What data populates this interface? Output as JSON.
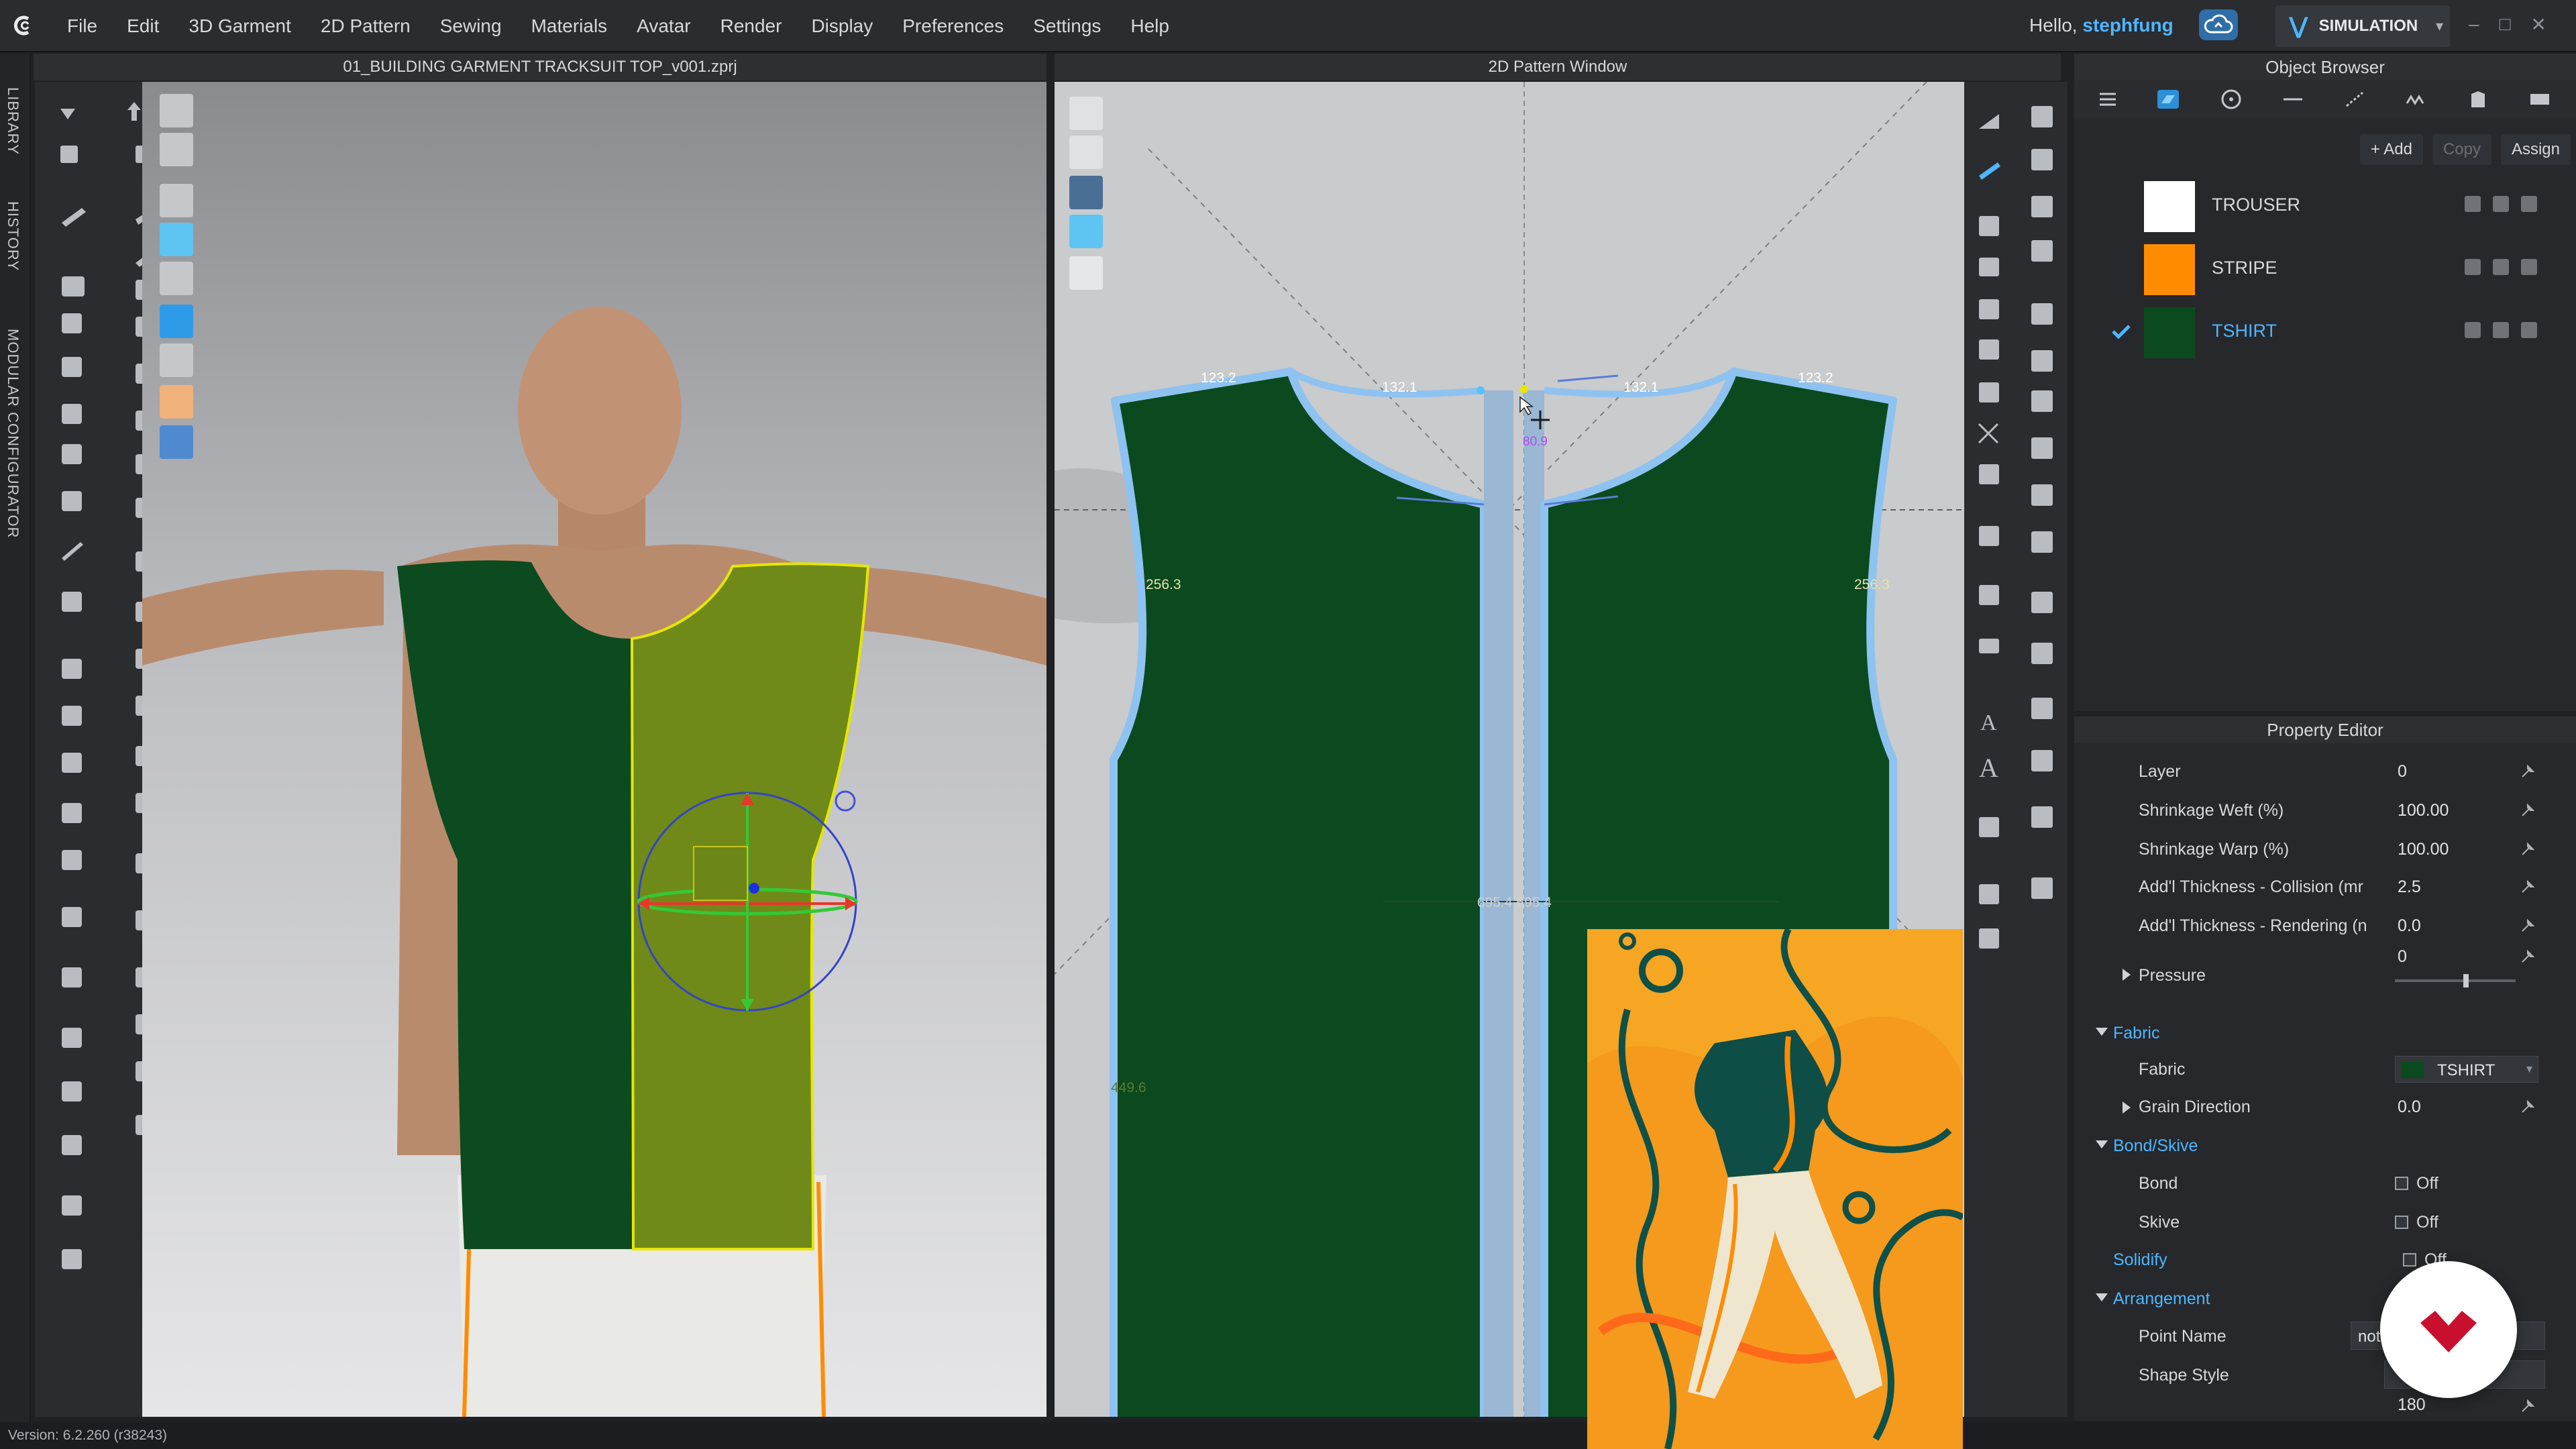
{
  "menubar": {
    "items": [
      "File",
      "Edit",
      "3D Garment",
      "2D Pattern",
      "Sewing",
      "Materials",
      "Avatar",
      "Render",
      "Display",
      "Preferences",
      "Settings",
      "Help"
    ],
    "greeting": "Hello,",
    "username": "stephfung",
    "mode_label": "SIMULATION"
  },
  "left_tabs": [
    "LIBRARY",
    "HISTORY",
    "MODULAR CONFIGURATOR"
  ],
  "window3d": {
    "title": "01_BUILDING GARMENT TRACKSUIT TOP_v001.zprj"
  },
  "window2d": {
    "title": "2D Pattern Window",
    "measurements": {
      "shoulder_left": "123.2",
      "neck_left": "132.1",
      "neck_right": "132.1",
      "shoulder_right": "123.2",
      "center_small": "80.9",
      "armhole_left": "256.3",
      "armhole_right": "256.3",
      "center_width": "695.4 695.4",
      "side_length": "449.6"
    }
  },
  "object_browser": {
    "title": "Object Browser",
    "actions": {
      "add": "+ Add",
      "copy": "Copy",
      "assign": "Assign"
    },
    "fabrics": [
      {
        "name": "TROUSER",
        "color": "#ffffff",
        "active": false
      },
      {
        "name": "STRIPE",
        "color": "#ff8c00",
        "active": false
      },
      {
        "name": "TSHIRT",
        "color": "#0b4a1e",
        "active": true
      }
    ]
  },
  "property_editor": {
    "title": "Property Editor",
    "layer": {
      "label": "Layer",
      "value": "0"
    },
    "shrink_weft": {
      "label": "Shrinkage Weft (%)",
      "value": "100.00"
    },
    "shrink_warp": {
      "label": "Shrinkage Warp (%)",
      "value": "100.00"
    },
    "thick_collision": {
      "label": "Add'l Thickness - Collision (mr",
      "value": "2.5"
    },
    "thick_render": {
      "label": "Add'l Thickness - Rendering (n",
      "value": "0.0"
    },
    "pressure_value": "0",
    "pressure": {
      "label": "Pressure"
    },
    "fabric_section": "Fabric",
    "fabric": {
      "label": "Fabric",
      "value": "TSHIRT"
    },
    "grain": {
      "label": "Grain Direction",
      "value": "0.0"
    },
    "bond_section": "Bond/Skive",
    "bond": {
      "label": "Bond",
      "value": "Off"
    },
    "skive": {
      "label": "Skive",
      "value": "Off"
    },
    "solidify": {
      "label": "Solidify",
      "value": "Off"
    },
    "arrangement_section": "Arrangement",
    "point_name": {
      "label": "Point Name",
      "value": "not"
    },
    "shape_style": {
      "label": "Shape Style",
      "value": ""
    },
    "orientation_value": "180"
  },
  "status": {
    "version": "Version: 6.2.260 (r38243)"
  },
  "colors": {
    "accent": "#4fb6ff",
    "tshirt_green": "#0b4a1e",
    "selected_pattern": "#6f8a18",
    "selection_outline": "#e6e600",
    "pattern_outline": "#8ec2f0",
    "stripe_orange": "#ff8c00",
    "thumb_bg": "#f6a623",
    "badge_red": "#c8102e"
  },
  "icons": {
    "logo": "clo-logo-icon",
    "cloud": "cloud-sync-icon",
    "simulation": "simulation-chevron-icon",
    "gizmo": "transform-gizmo-icon",
    "badge": "domestika-badge-icon"
  }
}
